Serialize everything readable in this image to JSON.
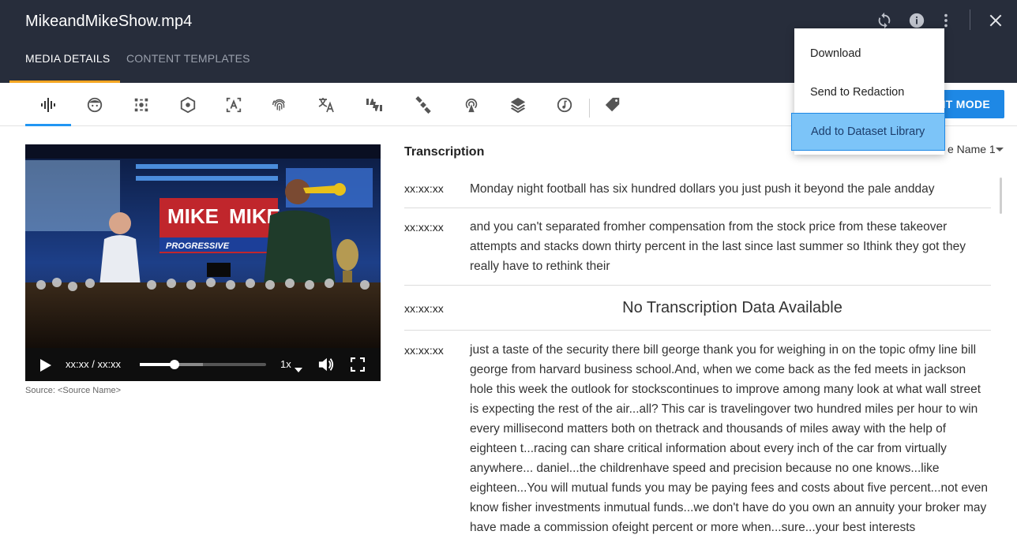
{
  "window": {
    "title": "MikeandMikeShow.mp4"
  },
  "header_tabs": [
    {
      "label": "MEDIA DETAILS"
    },
    {
      "label": "CONTENT TEMPLATES"
    }
  ],
  "header_icons": [
    "refresh-icon",
    "info-icon",
    "more-vert-icon",
    "close-icon"
  ],
  "toolbar": {
    "icons": [
      "transcription-waveform-icon",
      "face-icon",
      "object-icon",
      "logo-hexagon-icon",
      "text-recognition-icon",
      "fingerprint-icon",
      "translate-icon",
      "sentiment-thumbs-icon",
      "satellite-icon",
      "broadcast-icon",
      "layers-icon",
      "music-icon",
      "tag-icon"
    ],
    "edit_label": "EDIT MODE"
  },
  "menu": {
    "items": [
      {
        "label": "Download"
      },
      {
        "label": "Send to Redaction"
      },
      {
        "label": "Add to Dataset Library"
      }
    ]
  },
  "video": {
    "time": "xx:xx / xx:xx",
    "speed": "1x",
    "progress": 0.27,
    "buffered": 0.5,
    "source": "Source: <Source Name>"
  },
  "transcription": {
    "title": "Transcription",
    "source_select": "Source Name 1",
    "source_select_visible": "e Name 1",
    "rows": [
      {
        "time": "xx:xx:xx",
        "text": "Monday night football has six hundred dollars you just push it beyond the pale andday"
      },
      {
        "time": "xx:xx:xx",
        "text": "and you can't separated fromher compensation from the stock price from these takeover attempts and stacks down thirty percent in the last since last summer so Ithink they got they really have to rethink their"
      },
      {
        "time": "xx:xx:xx",
        "text": "No Transcription Data Available"
      },
      {
        "time": "xx:xx:xx",
        "text": "just a taste of the security there bill george thank you for weighing in on the topic ofmy line bill george from harvard business school.And, when we come back as the fed meets in jackson hole this week the outlook for stockscontinues to improve among many look at what wall street is expecting the rest of the air...all? This car is travelingover two hundred miles per hour to win every millisecond matters both on thetrack and thousands of miles away with the help of eighteen t...racing can share critical information about every inch of the car from virtually anywhere... daniel...the childrenhave speed and precision because no one knows...like eighteen...You will mutual funds you may be paying fees and costs about five percent...not even know fisher investments inmutual funds...we don't have do you own an annuity your broker may have made a commission ofeight percent or more when...sure...your best interests"
      }
    ]
  },
  "colors": {
    "header_bg": "#272d3b",
    "tab_accent": "#f5a623",
    "primary": "#1e88e5",
    "menu_highlight": "#7cc4f8"
  }
}
